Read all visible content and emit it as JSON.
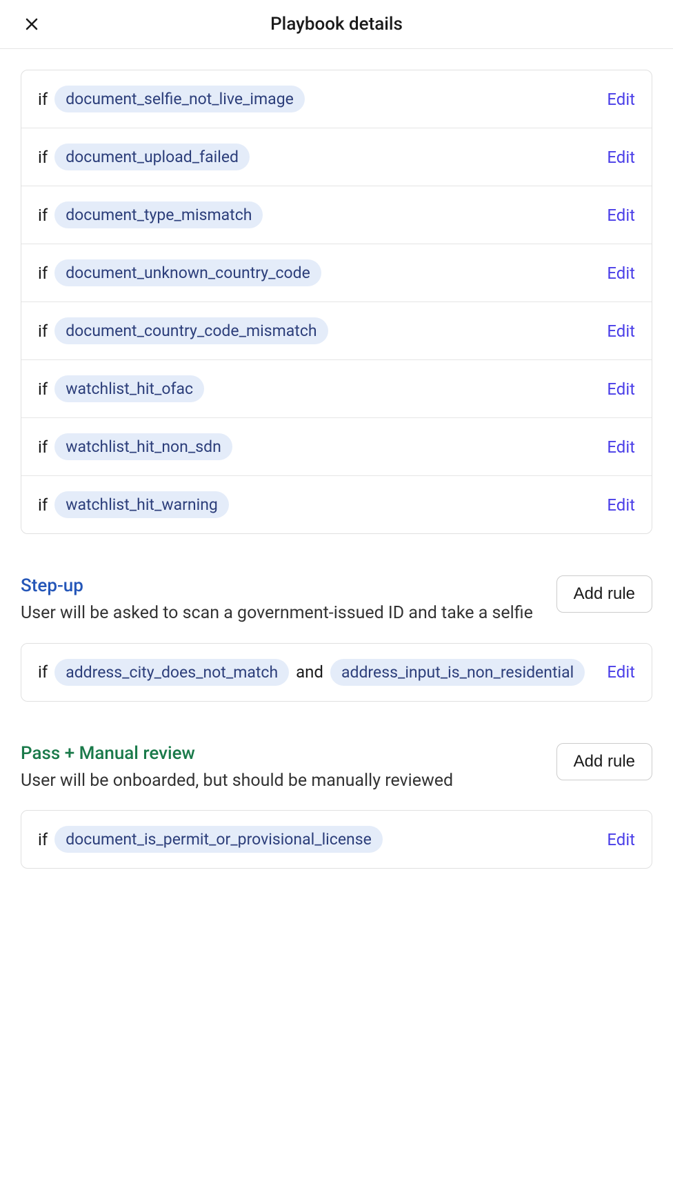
{
  "header": {
    "title": "Playbook details"
  },
  "labels": {
    "if": "if",
    "and": "and",
    "edit": "Edit",
    "add_rule": "Add rule"
  },
  "top_rules": [
    {
      "conditions": [
        "document_selfie_not_live_image"
      ]
    },
    {
      "conditions": [
        "document_upload_failed"
      ]
    },
    {
      "conditions": [
        "document_type_mismatch"
      ]
    },
    {
      "conditions": [
        "document_unknown_country_code"
      ]
    },
    {
      "conditions": [
        "document_country_code_mismatch"
      ]
    },
    {
      "conditions": [
        "watchlist_hit_ofac"
      ]
    },
    {
      "conditions": [
        "watchlist_hit_non_sdn"
      ]
    },
    {
      "conditions": [
        "watchlist_hit_warning"
      ]
    }
  ],
  "stepup": {
    "title": "Step-up",
    "desc": "User will be asked to scan a government-issued ID and take a selfie",
    "rules": [
      {
        "conditions": [
          "address_city_does_not_match",
          "address_input_is_non_residential"
        ]
      }
    ]
  },
  "pass": {
    "title": "Pass + Manual review",
    "desc": "User will be onboarded, but should be manually reviewed",
    "rules": [
      {
        "conditions": [
          "document_is_permit_or_provisional_license"
        ]
      }
    ]
  }
}
